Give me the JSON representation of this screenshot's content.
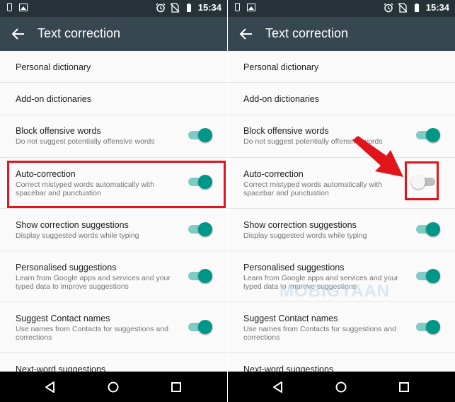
{
  "status_bar": {
    "time": "15:34"
  },
  "app_bar": {
    "title": "Text correction"
  },
  "settings": [
    {
      "title": "Personal dictionary",
      "summary": ""
    },
    {
      "title": "Add-on dictionaries",
      "summary": ""
    },
    {
      "title": "Block offensive words",
      "summary": "Do not suggest potentially offensive words",
      "left_state": "on",
      "right_state": "on"
    },
    {
      "title": "Auto-correction",
      "summary": "Correct mistyped words automatically with spacebar and punctuation",
      "left_state": "on",
      "right_state": "off"
    },
    {
      "title": "Show correction suggestions",
      "summary": "Display suggested words while typing",
      "left_state": "on",
      "right_state": "on"
    },
    {
      "title": "Personalised suggestions",
      "summary": "Learn from Google apps and services and your typed data to improve suggestions",
      "left_state": "on",
      "right_state": "on"
    },
    {
      "title": "Suggest Contact names",
      "summary": "Use names from Contacts for suggestions and corrections",
      "left_state": "on",
      "right_state": "on"
    },
    {
      "title": "Next-word suggestions",
      "summary": ""
    }
  ],
  "nav_icons": [
    "back-triangle-icon",
    "home-circle-icon",
    "recents-square-icon"
  ],
  "watermark": "MOBIGYAAN",
  "colors": {
    "status_bar": "#263238",
    "app_bar": "#37474f",
    "switch_on": "#009688",
    "switch_track_on": "#80cbc4",
    "switch_off": "#f5f5f5",
    "annotation": "#e1141b"
  }
}
